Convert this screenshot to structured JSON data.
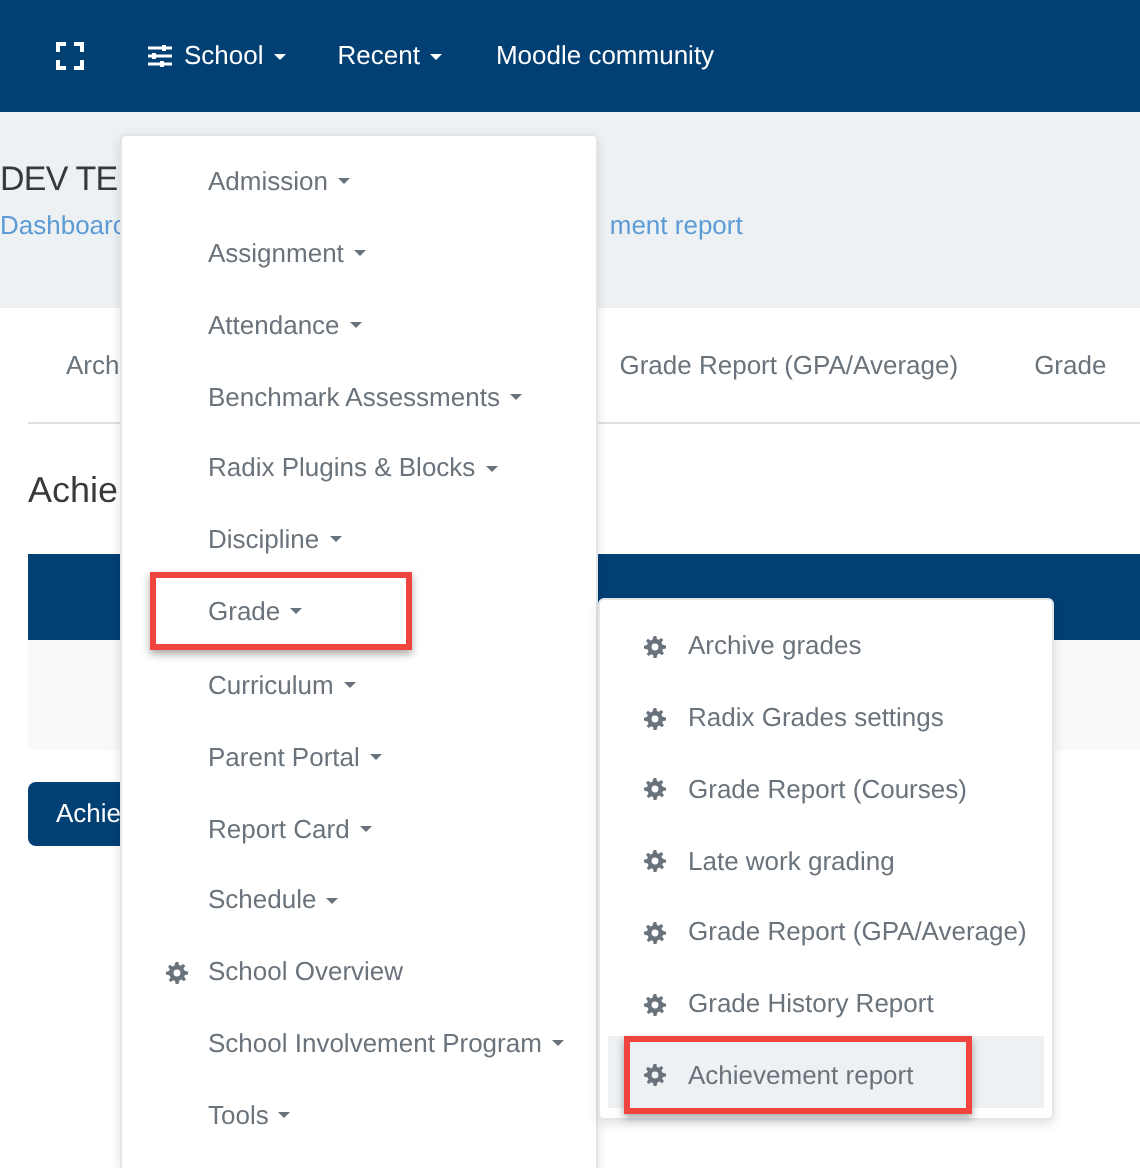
{
  "navbar": {
    "items": [
      {
        "label": "School",
        "kind": "dropdown"
      },
      {
        "label": "Recent",
        "kind": "dropdown"
      },
      {
        "label": "Moodle community",
        "kind": "link"
      }
    ]
  },
  "page_header": {
    "title": "DEV TE",
    "breadcrumb": [
      {
        "label": "Dashboarc"
      },
      {
        "label": "ment report"
      }
    ]
  },
  "tabs": [
    {
      "label": "Arch"
    },
    {
      "label": "Grade Report (GPA/Average)"
    },
    {
      "label": "Grade"
    }
  ],
  "heading": "Achie",
  "button": "Achie",
  "menu": {
    "items": [
      {
        "label": "Admission",
        "kind": "submenu",
        "highlighted": false
      },
      {
        "label": "Assignment",
        "kind": "submenu",
        "highlighted": false
      },
      {
        "label": "Attendance",
        "kind": "submenu",
        "highlighted": false
      },
      {
        "label": "Benchmark Assessments",
        "kind": "submenu",
        "highlighted": false
      },
      {
        "label": "Radix Plugins & Blocks",
        "kind": "submenu",
        "highlighted": false
      },
      {
        "label": "Discipline",
        "kind": "submenu",
        "highlighted": false
      },
      {
        "label": "Grade",
        "kind": "submenu",
        "highlighted": true
      },
      {
        "label": "Curriculum",
        "kind": "submenu",
        "highlighted": false
      },
      {
        "label": "Parent Portal",
        "kind": "submenu",
        "highlighted": false
      },
      {
        "label": "Report Card",
        "kind": "submenu",
        "highlighted": false
      },
      {
        "label": "Schedule",
        "kind": "submenu",
        "highlighted": false
      },
      {
        "label": "School Overview",
        "kind": "link",
        "highlighted": false
      },
      {
        "label": "School Involvement Program",
        "kind": "submenu",
        "highlighted": false
      },
      {
        "label": "Tools",
        "kind": "submenu",
        "highlighted": false
      }
    ]
  },
  "submenu": {
    "items": [
      {
        "label": "Archive grades",
        "kind": "link",
        "selected": false,
        "highlighted": false
      },
      {
        "label": "Radix Grades settings",
        "kind": "link",
        "selected": false,
        "highlighted": false
      },
      {
        "label": "Grade Report (Courses)",
        "kind": "link",
        "selected": false,
        "highlighted": false
      },
      {
        "label": "Late work grading",
        "kind": "link",
        "selected": false,
        "highlighted": false
      },
      {
        "label": "Grade Report (GPA/Average)",
        "kind": "link",
        "selected": false,
        "highlighted": false
      },
      {
        "label": "Grade History Report",
        "kind": "link",
        "selected": false,
        "highlighted": false
      },
      {
        "label": "Achievement report",
        "kind": "link",
        "selected": true,
        "highlighted": true
      }
    ]
  }
}
